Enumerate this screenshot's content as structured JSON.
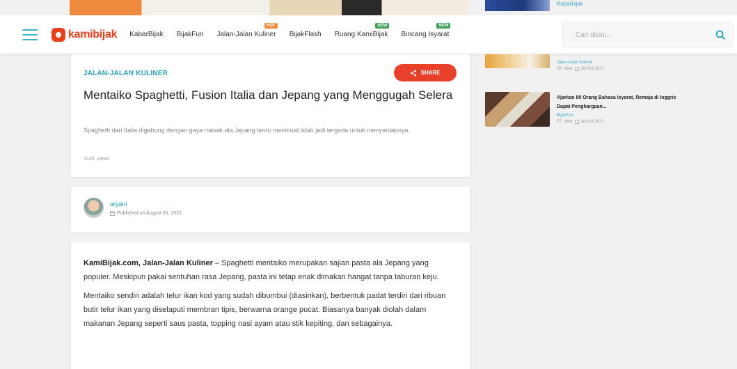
{
  "header": {
    "logo_text": "kamibijak",
    "nav": [
      {
        "label": "KabarBijak",
        "badge": ""
      },
      {
        "label": "BijakFun",
        "badge": ""
      },
      {
        "label": "Jalan-Jalan Kuliner",
        "badge": "HOT"
      },
      {
        "label": "BijakFlash",
        "badge": ""
      },
      {
        "label": "Ruang KamiBijak",
        "badge": "NEW"
      },
      {
        "label": "Bincang Isyarat",
        "badge": "NEW"
      }
    ],
    "search_placeholder": "Cari disini..."
  },
  "article": {
    "category": "JALAN-JALAN KULINER",
    "share_label": "SHARE",
    "title": "Mentaiko Spaghetti, Fusion Italia dan Jepang yang Menggugah Selera",
    "description": "Spaghetti dari Italia digabung dengan gaya masak ala Jepang tentu membuat lidah jadi tergoda untuk menyantapnya.",
    "views_count": "4145",
    "views_label": "views"
  },
  "author": {
    "name": "aryani",
    "published": "Published on August 05, 2021"
  },
  "body": {
    "p1_bold": "KamiBijak.com, Jalan-Jalan Kuliner",
    "p1_rest": " – Spaghetti mentaiko merupakan sajian pasta ala Jepang yang populer. Meskipun pakai sentuhan rasa Jepang, pasta ini tetap enak dimakan hangat tanpa taburan keju.",
    "p2": "Mentaiko sendiri adalah telur ikan kod yang sudah dibumbui (diasinkan), berbentuk padat terdiri dari ribuan butir telur ikan yang diselaputi membran tipis, berwarna orange pucat. Biasanya banyak diolah dalam makanan Jepang seperti saus pasta, topping nasi ayam atau stik kepiting, dan sebagainya."
  },
  "sidebar": {
    "top_link": "Kabarbijak",
    "items": [
      {
        "title": "",
        "category": "Jalan-Jalan Kuliner",
        "views": "59",
        "views_label": "View",
        "date": "26-Oct-2021"
      },
      {
        "title": "Ajarkan 80 Orang Bahasa Isyarat, Remaja di Inggris Dapat Penghargaan...",
        "category": "BijakFun",
        "views": "57",
        "views_label": "View",
        "date": "26-Oct-2021"
      }
    ]
  },
  "colors": {
    "accent_teal": "#2aa0bd",
    "brand_red": "#e8401c",
    "share_red": "#e8402a",
    "badge_hot": "#f08a3c",
    "badge_new": "#3ca05a"
  }
}
